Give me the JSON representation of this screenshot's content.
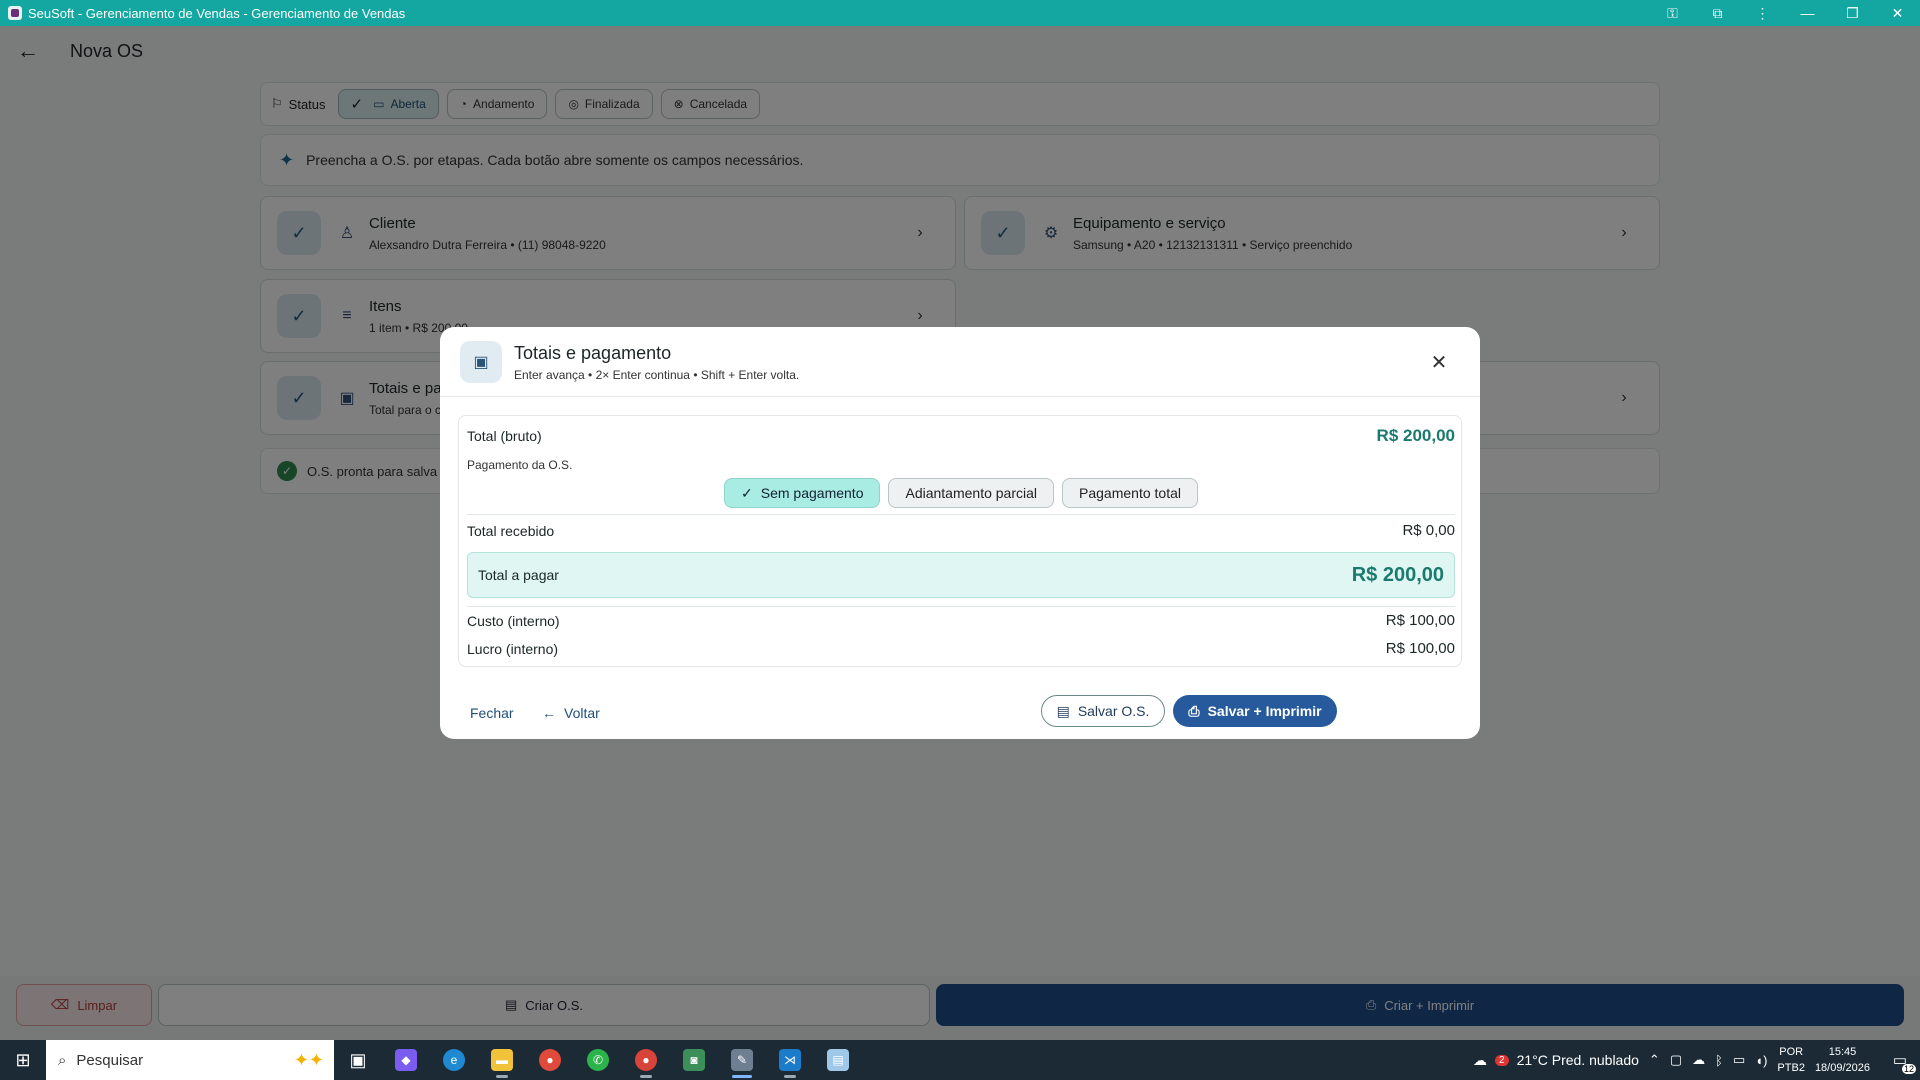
{
  "window": {
    "title": "SeuSoft - Gerenciamento de Vendas - Gerenciamento de Vendas"
  },
  "appbar": {
    "title": "Nova OS"
  },
  "status": {
    "label": "Status",
    "chips": [
      {
        "label": "Aberta",
        "selected": true
      },
      {
        "label": "Andamento",
        "selected": false
      },
      {
        "label": "Finalizada",
        "selected": false
      },
      {
        "label": "Cancelada",
        "selected": false
      }
    ]
  },
  "hint": {
    "text": "Preencha a O.S. por etapas. Cada botão abre somente os campos necessários."
  },
  "steps": {
    "client": {
      "title": "Cliente",
      "subtitle": "Alexsandro Dutra Ferreira • (11) 98048-9220"
    },
    "equipment": {
      "title": "Equipamento e serviço",
      "subtitle": "Samsung • A20 • 12132131311 • Serviço preenchido"
    },
    "items": {
      "title": "Itens",
      "subtitle": "1 item • R$ 200,00"
    },
    "totals": {
      "title": "Totais e pa",
      "subtitle": "Total para o c"
    }
  },
  "ready": {
    "text": "O.S. pronta para salva"
  },
  "bottom": {
    "clear": "Limpar",
    "create": "Criar O.S.",
    "create_print": "Criar + Imprimir"
  },
  "dialog": {
    "title": "Totais e pagamento",
    "subtitle": "Enter avança • 2× Enter continua • Shift + Enter volta.",
    "gross_label": "Total (bruto)",
    "gross_value": "R$ 200,00",
    "payment_label": "Pagamento da O.S.",
    "payment_options": [
      {
        "label": "Sem pagamento",
        "selected": true
      },
      {
        "label": "Adiantamento parcial",
        "selected": false
      },
      {
        "label": "Pagamento total",
        "selected": false
      }
    ],
    "received_label": "Total recebido",
    "received_value": "R$ 0,00",
    "to_pay_label": "Total a pagar",
    "to_pay_value": "R$ 200,00",
    "cost_label": "Custo (interno)",
    "cost_value": "R$ 100,00",
    "profit_label": "Lucro (interno)",
    "profit_value": "R$ 100,00",
    "close_text": "Fechar",
    "back_text": "Voltar",
    "save_text": "Salvar O.S.",
    "save_print_text": "Salvar + Imprimir"
  },
  "taskbar": {
    "search_placeholder": "Pesquisar",
    "weather_badge": "2",
    "weather": "21°C  Pred. nublado",
    "lang_line1": "POR",
    "lang_line2": "PTB2",
    "time": "15:45",
    "date": "18/09/2026",
    "notifications": "12"
  },
  "colors": {
    "titlebar": "#14a6a0",
    "accent_teal": "#1b7a6e",
    "primary_blue": "#275a9c",
    "bottom_primary": "#1f4d8a",
    "danger": "#b33a3a"
  }
}
